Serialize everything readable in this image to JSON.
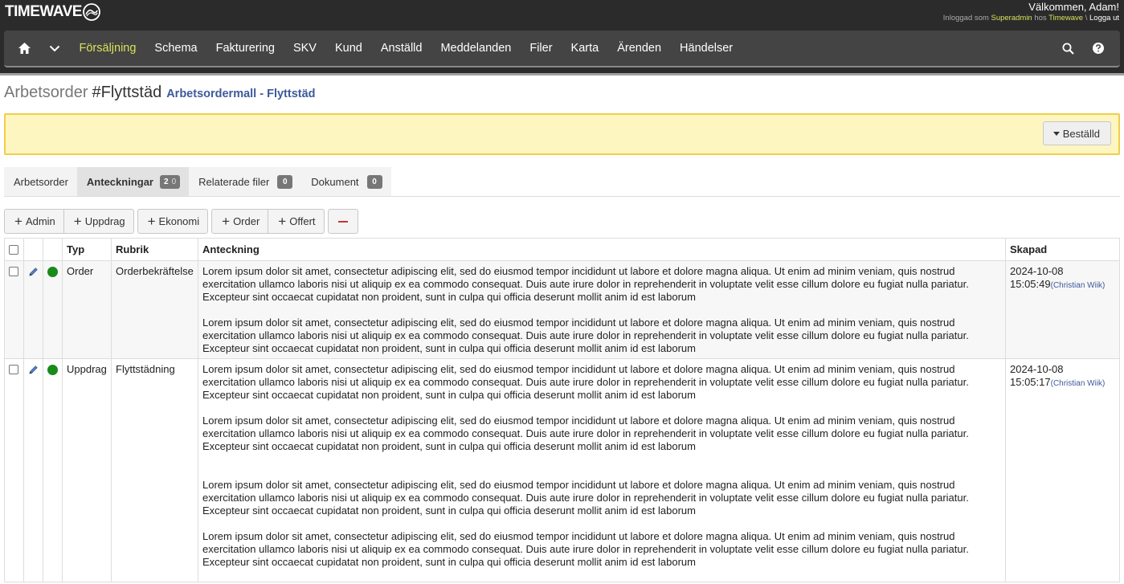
{
  "header": {
    "logo": "TIMEWAVE",
    "greeting": "Välkommen, Adam!",
    "logged_in_as": "Inloggad som",
    "role": "Superadmin",
    "at": "hos",
    "company": "Timewave",
    "separator": "\\",
    "logout": "Logga ut"
  },
  "nav": {
    "items": [
      "Försäljning",
      "Schema",
      "Fakturering",
      "SKV",
      "Kund",
      "Anställd",
      "Meddelanden",
      "Filer",
      "Karta",
      "Ärenden",
      "Händelser"
    ],
    "active_index": 0,
    "icons": [
      "home-icon",
      "chevron-down-icon",
      "search-icon",
      "help-icon"
    ]
  },
  "page": {
    "title_prefix": "Arbetsorder",
    "title_number": "#Flyttstäd",
    "template_link": "Arbetsordermall - Flyttstäd",
    "status_button": "Beställd"
  },
  "tabs": [
    {
      "label": "Arbetsorder"
    },
    {
      "label": "Anteckningar",
      "badge": "2",
      "badge2": "0"
    },
    {
      "label": "Relaterade filer",
      "badge": "0"
    },
    {
      "label": "Dokument",
      "badge": "0"
    }
  ],
  "toolbar": {
    "admin": "Admin",
    "uppdrag": "Uppdrag",
    "ekonomi": "Ekonomi",
    "order": "Order",
    "offert": "Offert"
  },
  "table": {
    "headers": {
      "typ": "Typ",
      "rubrik": "Rubrik",
      "anteckning": "Anteckning",
      "skapad": "Skapad"
    },
    "rows": [
      {
        "typ": "Order",
        "rubrik": "Orderbekräftelse",
        "paragraphs": [
          "Lorem ipsum dolor sit amet, consectetur adipiscing elit, sed do eiusmod tempor incididunt ut labore et dolore magna aliqua. Ut enim ad minim veniam, quis nostrud exercitation ullamco laboris nisi ut aliquip ex ea commodo consequat. Duis aute irure dolor in reprehenderit in voluptate velit esse cillum dolore eu fugiat nulla pariatur. Excepteur sint occaecat cupidatat non proident, sunt in culpa qui officia deserunt mollit anim id est laborum",
          "Lorem ipsum dolor sit amet, consectetur adipiscing elit, sed do eiusmod tempor incididunt ut labore et dolore magna aliqua. Ut enim ad minim veniam, quis nostrud exercitation ullamco laboris nisi ut aliquip ex ea commodo consequat. Duis aute irure dolor in reprehenderit in voluptate velit esse cillum dolore eu fugiat nulla pariatur. Excepteur sint occaecat cupidatat non proident, sunt in culpa qui officia deserunt mollit anim id est laborum"
        ],
        "date": "2024-10-08",
        "time": "15:05:49",
        "user": "(Christian Wiik)",
        "status_color": "#1a8a1a"
      },
      {
        "typ": "Uppdrag",
        "rubrik": "Flyttstädning",
        "paragraphs": [
          "Lorem ipsum dolor sit amet, consectetur adipiscing elit, sed do eiusmod tempor incididunt ut labore et dolore magna aliqua. Ut enim ad minim veniam, quis nostrud exercitation ullamco laboris nisi ut aliquip ex ea commodo consequat. Duis aute irure dolor in reprehenderit in voluptate velit esse cillum dolore eu fugiat nulla pariatur. Excepteur sint occaecat cupidatat non proident, sunt in culpa qui officia deserunt mollit anim id est laborum",
          "Lorem ipsum dolor sit amet, consectetur adipiscing elit, sed do eiusmod tempor incididunt ut labore et dolore magna aliqua. Ut enim ad minim veniam, quis nostrud exercitation ullamco laboris nisi ut aliquip ex ea commodo consequat. Duis aute irure dolor in reprehenderit in voluptate velit esse cillum dolore eu fugiat nulla pariatur. Excepteur sint occaecat cupidatat non proident, sunt in culpa qui officia deserunt mollit anim id est laborum",
          "Lorem ipsum dolor sit amet, consectetur adipiscing elit, sed do eiusmod tempor incididunt ut labore et dolore magna aliqua. Ut enim ad minim veniam, quis nostrud exercitation ullamco laboris nisi ut aliquip ex ea commodo consequat. Duis aute irure dolor in reprehenderit in voluptate velit esse cillum dolore eu fugiat nulla pariatur. Excepteur sint occaecat cupidatat non proident, sunt in culpa qui officia deserunt mollit anim id est laborum",
          "Lorem ipsum dolor sit amet, consectetur adipiscing elit, sed do eiusmod tempor incididunt ut labore et dolore magna aliqua. Ut enim ad minim veniam, quis nostrud exercitation ullamco laboris nisi ut aliquip ex ea commodo consequat. Duis aute irure dolor in reprehenderit in voluptate velit esse cillum dolore eu fugiat nulla pariatur. Excepteur sint occaecat cupidatat non proident, sunt in culpa qui officia deserunt mollit anim id est laborum"
        ],
        "date": "2024-10-08",
        "time": "15:05:17",
        "user": "(Christian Wiik)",
        "status_color": "#1a8a1a"
      }
    ]
  },
  "colors": {
    "header_bg": "#2b2b2b",
    "nav_bg": "#444444",
    "nav_active": "#d8e25a",
    "link": "#3d5a9a",
    "alert_bg": "#fdf6c0",
    "alert_border": "#f1cd4a",
    "status_green": "#1a8a1a"
  }
}
